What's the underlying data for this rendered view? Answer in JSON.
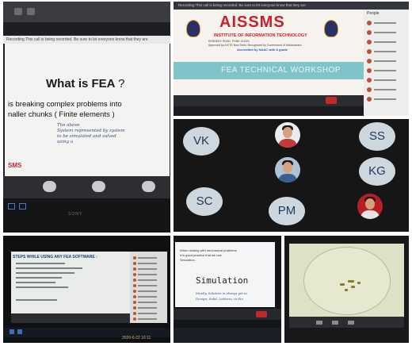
{
  "panel_fea": {
    "recording_notice": "Recording  This call is being recorded. Be sure to let everyone know that they are",
    "slide_title": "What is FEA",
    "slide_title_mark": "?",
    "line1": "is breaking complex problems into",
    "line2": "naller chunks ( Finite elements )",
    "handwriting": [
      "The above",
      "System represented by system",
      "to be simulated and solved",
      "using a"
    ],
    "logo_text": "SMS",
    "brand": "SONY"
  },
  "panel_aissms": {
    "recording_notice": "Recording  This call is being recorded. Be sure to let everyone know that they are",
    "title": "AISSMS",
    "institute": "INSTITUTE OF INFORMATION TECHNOLOGY",
    "small_lines": [
      "KENNEDY ROAD, PUNE 411001",
      "Approved by AICTE New Delhi, Recognized by Government of Maharashtra"
    ],
    "accredited": "Accredited by NAAC with A grade",
    "band_text": "FEA TECHNICAL WORKSHOP",
    "participants_title": "People",
    "participant_count": 9
  },
  "panel_grid": {
    "tiles": [
      {
        "type": "initials",
        "text": "VK"
      },
      {
        "type": "photo"
      },
      {
        "type": "initials",
        "text": "SS"
      },
      {
        "type": "photo"
      },
      {
        "type": "initials",
        "text": "KG"
      },
      {
        "type": "initials",
        "text": "SC"
      },
      {
        "type": "initials",
        "text": "PM"
      },
      {
        "type": "photo"
      }
    ]
  },
  "panel_steps": {
    "heading": "STEPS WHILE USING ANY FEA SOFTWARE :",
    "timestamp": "2020-6-22  16:11"
  },
  "panel_simulation": {
    "intro": "When dealing with mechanical problems",
    "intro2": "it is good practice that we use",
    "intro3": "Simulation.",
    "word": "Simulation",
    "notes": [
      "Mostly, Solution is always yet in",
      "Design, Solid, Lotteria, in the"
    ]
  },
  "panel_whiteboard": {}
}
